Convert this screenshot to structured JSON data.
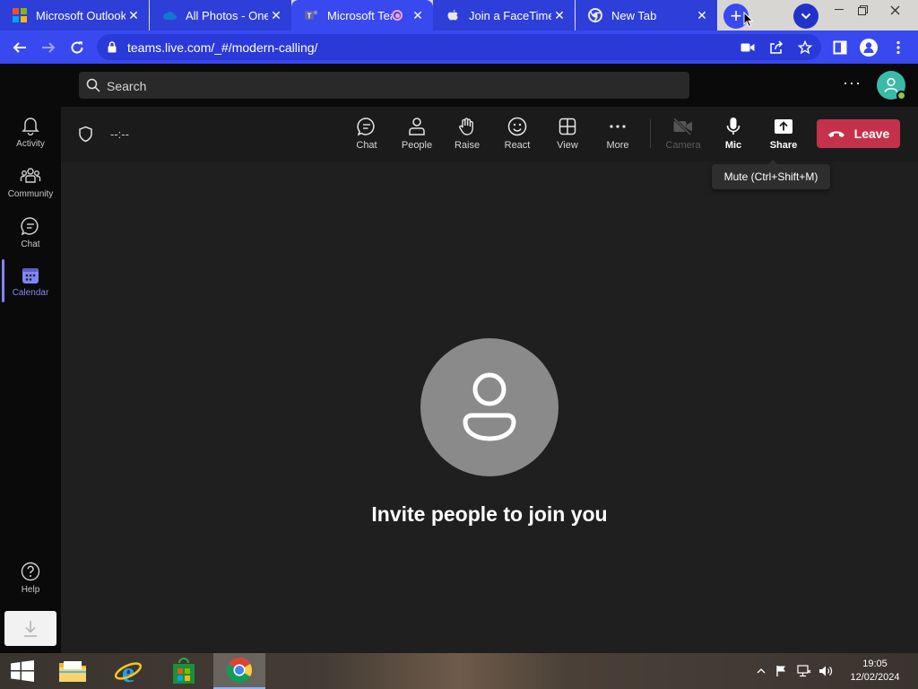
{
  "browser": {
    "tabs": [
      {
        "title": "Microsoft Outlook",
        "icon": "windows-logo-icon",
        "active": false
      },
      {
        "title": "All Photos - OneDrive",
        "icon": "onedrive-cloud-icon",
        "active": false
      },
      {
        "title": "Microsoft Teams",
        "icon": "teams-logo-icon",
        "active": true,
        "recording": true
      },
      {
        "title": "Join a FaceTime call",
        "icon": "apple-logo-icon",
        "active": false
      },
      {
        "title": "New Tab",
        "icon": "chrome-logo-icon",
        "active": false
      }
    ],
    "close_glyph": "✕",
    "new_tab_glyph": "+",
    "address": "teams.live.com/_#/modern-calling/",
    "accent_color": "#3949f0"
  },
  "teams": {
    "search_placeholder": "Search",
    "more_glyph": "···",
    "rail": [
      {
        "label": "Activity",
        "icon": "bell-icon"
      },
      {
        "label": "Community",
        "icon": "community-icon"
      },
      {
        "label": "Chat",
        "icon": "chat-icon"
      },
      {
        "label": "Calendar",
        "icon": "calendar-icon",
        "active": true
      },
      {
        "label": "Help",
        "icon": "help-icon"
      }
    ],
    "call": {
      "timer": "--:--",
      "toolbar": [
        {
          "label": "Chat",
          "icon": "chat-bubble-icon"
        },
        {
          "label": "People",
          "icon": "people-icon"
        },
        {
          "label": "Raise",
          "icon": "raise-hand-icon"
        },
        {
          "label": "React",
          "icon": "react-smiley-icon"
        },
        {
          "label": "View",
          "icon": "view-grid-icon"
        },
        {
          "label": "More",
          "icon": "more-dots-icon"
        },
        {
          "label": "Camera",
          "icon": "camera-off-icon",
          "disabled": true
        },
        {
          "label": "Mic",
          "icon": "mic-icon"
        },
        {
          "label": "Share",
          "icon": "share-screen-icon"
        }
      ],
      "leave_label": "Leave",
      "leave_color": "#c4314b",
      "tooltip": "Mute (Ctrl+Shift+M)",
      "invite_text": "Invite people to join you"
    }
  },
  "taskbar": {
    "apps": [
      "file-explorer-icon",
      "internet-explorer-icon",
      "store-icon",
      "chrome-icon"
    ],
    "active_app": "chrome-icon",
    "time": "19:05",
    "date": "12/02/2024"
  }
}
